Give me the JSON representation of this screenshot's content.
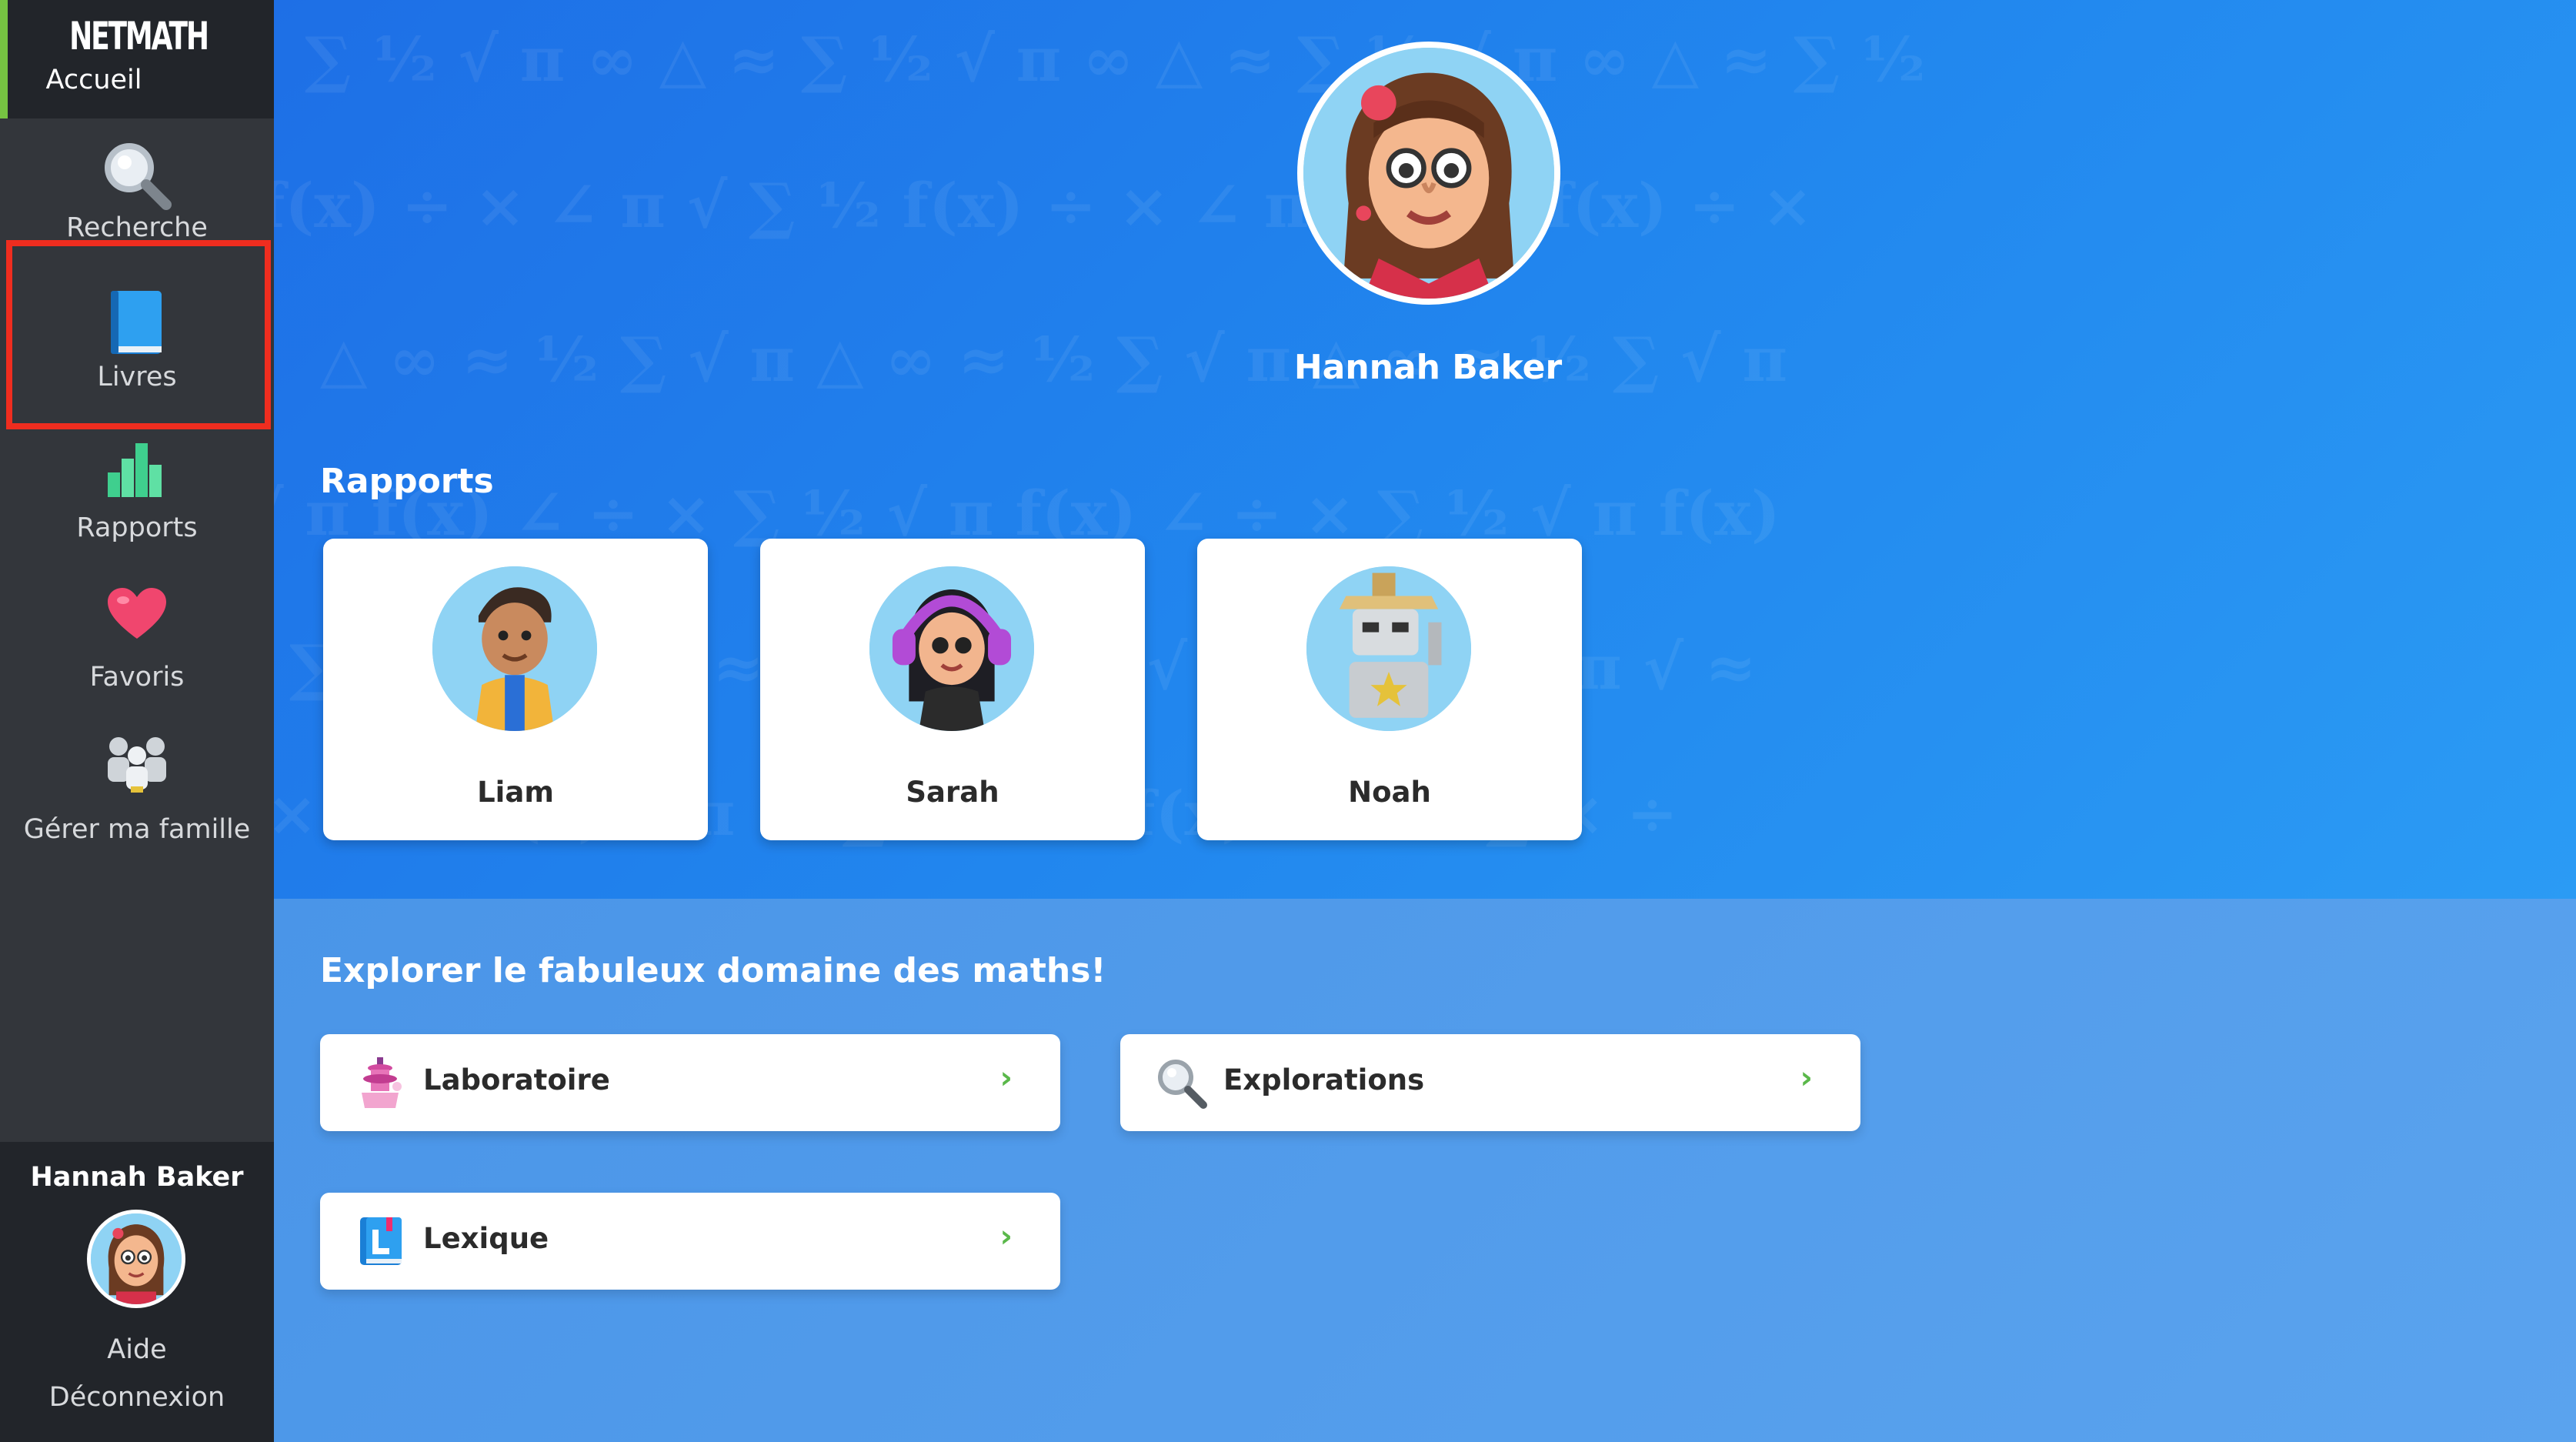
{
  "brand": {
    "logo": "NETMATH",
    "home_label": "Accueil"
  },
  "sidebar": {
    "items": [
      {
        "label": "Recherche",
        "icon": "magnifier-icon"
      },
      {
        "label": "Livres",
        "icon": "book-icon"
      },
      {
        "label": "Rapports",
        "icon": "bar-chart-icon"
      },
      {
        "label": "Favoris",
        "icon": "heart-icon"
      },
      {
        "label": "Gérer ma famille",
        "icon": "family-icon"
      }
    ],
    "user_name": "Hannah Baker",
    "help_label": "Aide",
    "logout_label": "Déconnexion"
  },
  "profile": {
    "name": "Hannah Baker"
  },
  "reports": {
    "title": "Rapports",
    "children": [
      {
        "name": "Liam"
      },
      {
        "name": "Sarah"
      },
      {
        "name": "Noah"
      }
    ]
  },
  "explore": {
    "title": "Explorer le fabuleux domaine des maths!",
    "links": [
      {
        "label": "Laboratoire",
        "icon": "lab-tower-icon"
      },
      {
        "label": "Explorations",
        "icon": "magnifier-icon"
      },
      {
        "label": "Lexique",
        "icon": "lexicon-book-icon"
      }
    ],
    "chevron": "›"
  },
  "colors": {
    "accent_green": "#76c442",
    "highlight_red": "#ef2d1f",
    "sidebar_bg": "#33363b",
    "main_blue": "#2186ee"
  }
}
